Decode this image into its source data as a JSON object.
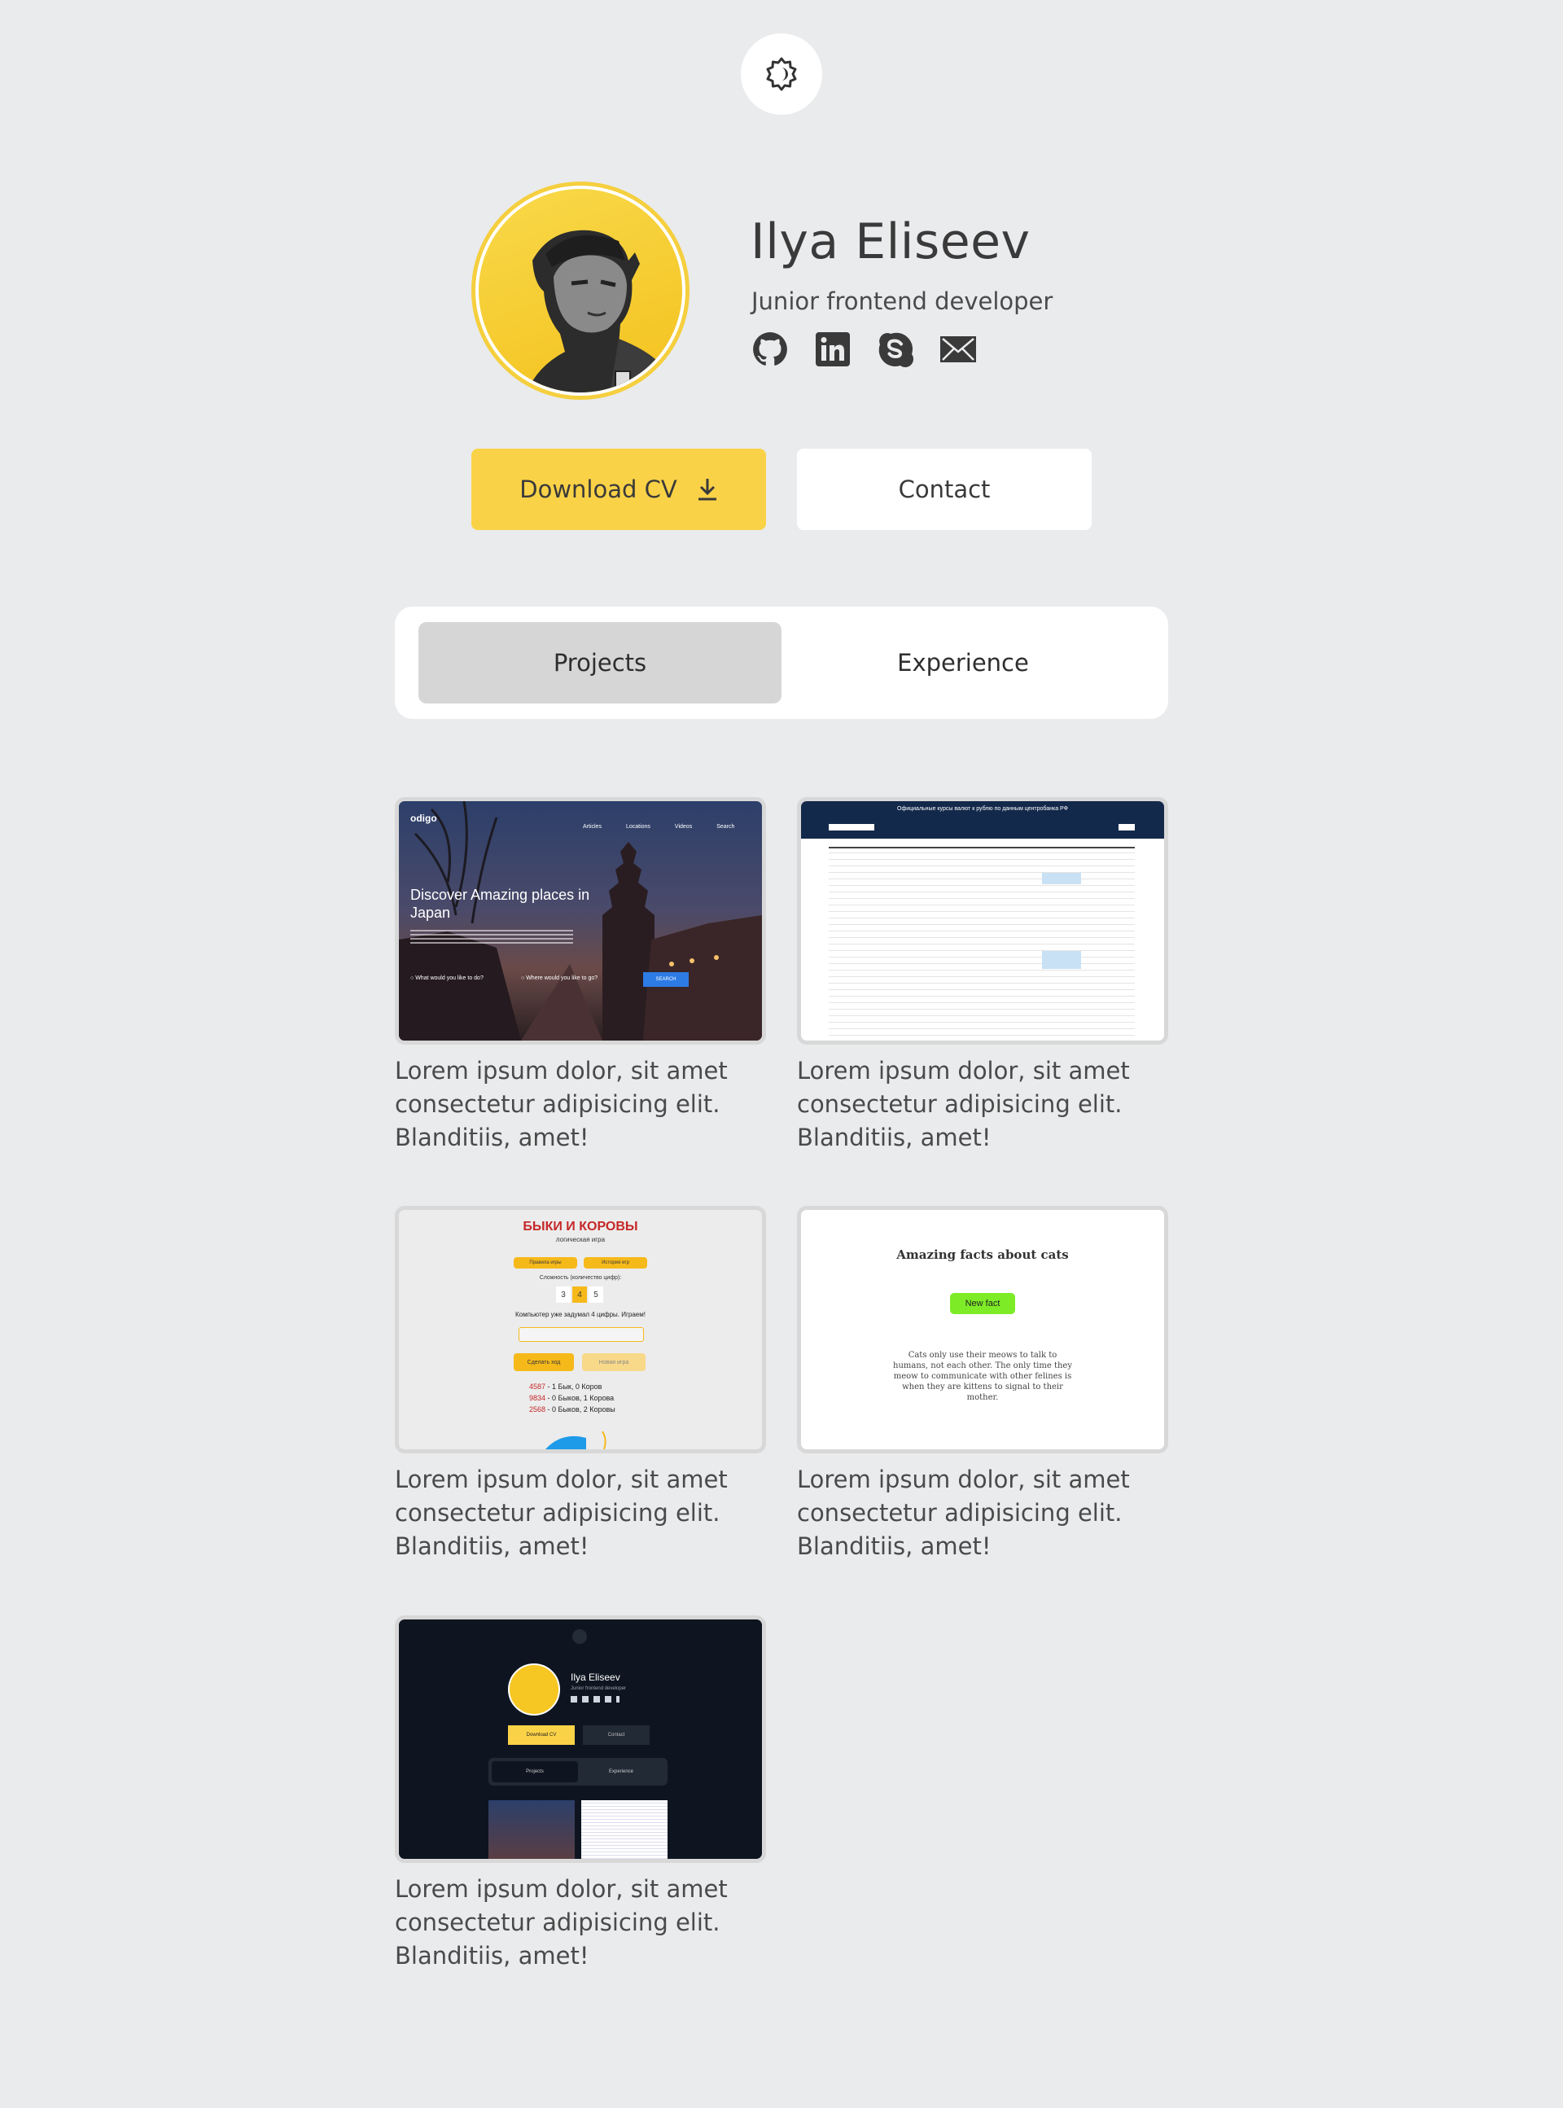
{
  "theme_toggle": {
    "icon": "gear-icon"
  },
  "profile": {
    "name": "Ilya Eliseev",
    "role": "Junior frontend developer",
    "socials": [
      "github-icon",
      "linkedin-icon",
      "skype-icon",
      "mail-icon"
    ]
  },
  "actions": {
    "download_label": "Download CV",
    "contact_label": "Contact"
  },
  "tabs": [
    {
      "label": "Projects",
      "active": true
    },
    {
      "label": "Experience",
      "active": false
    }
  ],
  "projects": [
    {
      "description": "Lorem ipsum dolor, sit amet consectetur adipisicing elit. Blanditiis, amet!",
      "preview": {
        "logo": "odigo",
        "nav": [
          "Articles",
          "Locations",
          "Videos",
          "Search"
        ],
        "headline": "Discover Amazing places in Japan",
        "field1": "What would you like to do?",
        "field2": "Where would you like to go?",
        "button": "SEARCH"
      }
    },
    {
      "description": "Lorem ipsum dolor, sit amet consectetur adipisicing elit. Blanditiis, amet!",
      "preview": {
        "title": "Официальные курсы валют к рублю по данным центробанка РФ"
      }
    },
    {
      "description": "Lorem ipsum dolor, sit amet consectetur adipisicing elit. Blanditiis, amet!",
      "preview": {
        "title": "БЫКИ И КОРОВЫ",
        "subtitle": "логическая игра",
        "btn_rules": "Правила игры",
        "btn_history": "История игр",
        "difficulty": "Сложность (количество цифр):",
        "digits": [
          "3",
          "4",
          "5"
        ],
        "message": "Компьютер уже задумал 4 цифры. Играем!",
        "btn_move": "Сделать ход",
        "btn_new": "Новая игра",
        "moves": [
          {
            "num": "4587",
            "text": " - 1 Бык, 0 Коров"
          },
          {
            "num": "9834",
            "text": " - 0 Быков, 1 Корова"
          },
          {
            "num": "2568",
            "text": " - 0 Быков, 2 Коровы"
          }
        ]
      }
    },
    {
      "description": "Lorem ipsum dolor, sit amet consectetur adipisicing elit. Blanditiis, amet!",
      "preview": {
        "title": "Amazing facts about cats",
        "button": "New fact",
        "fact": "Cats only use their meows to talk to humans, not each other. The only time they meow to communicate with other felines is when they are kittens to signal to their mother."
      }
    },
    {
      "description": "Lorem ipsum dolor, sit amet consectetur adipisicing elit. Blanditiis, amet!",
      "preview": {
        "name": "Ilya Eliseev",
        "role": "Junior frontend developer",
        "download": "Download CV",
        "contact": "Contact",
        "tab1": "Projects",
        "tab2": "Experience"
      }
    }
  ],
  "colors": {
    "accent": "#fad247",
    "background": "#eaebed",
    "tab_active": "#d6d6d6"
  }
}
